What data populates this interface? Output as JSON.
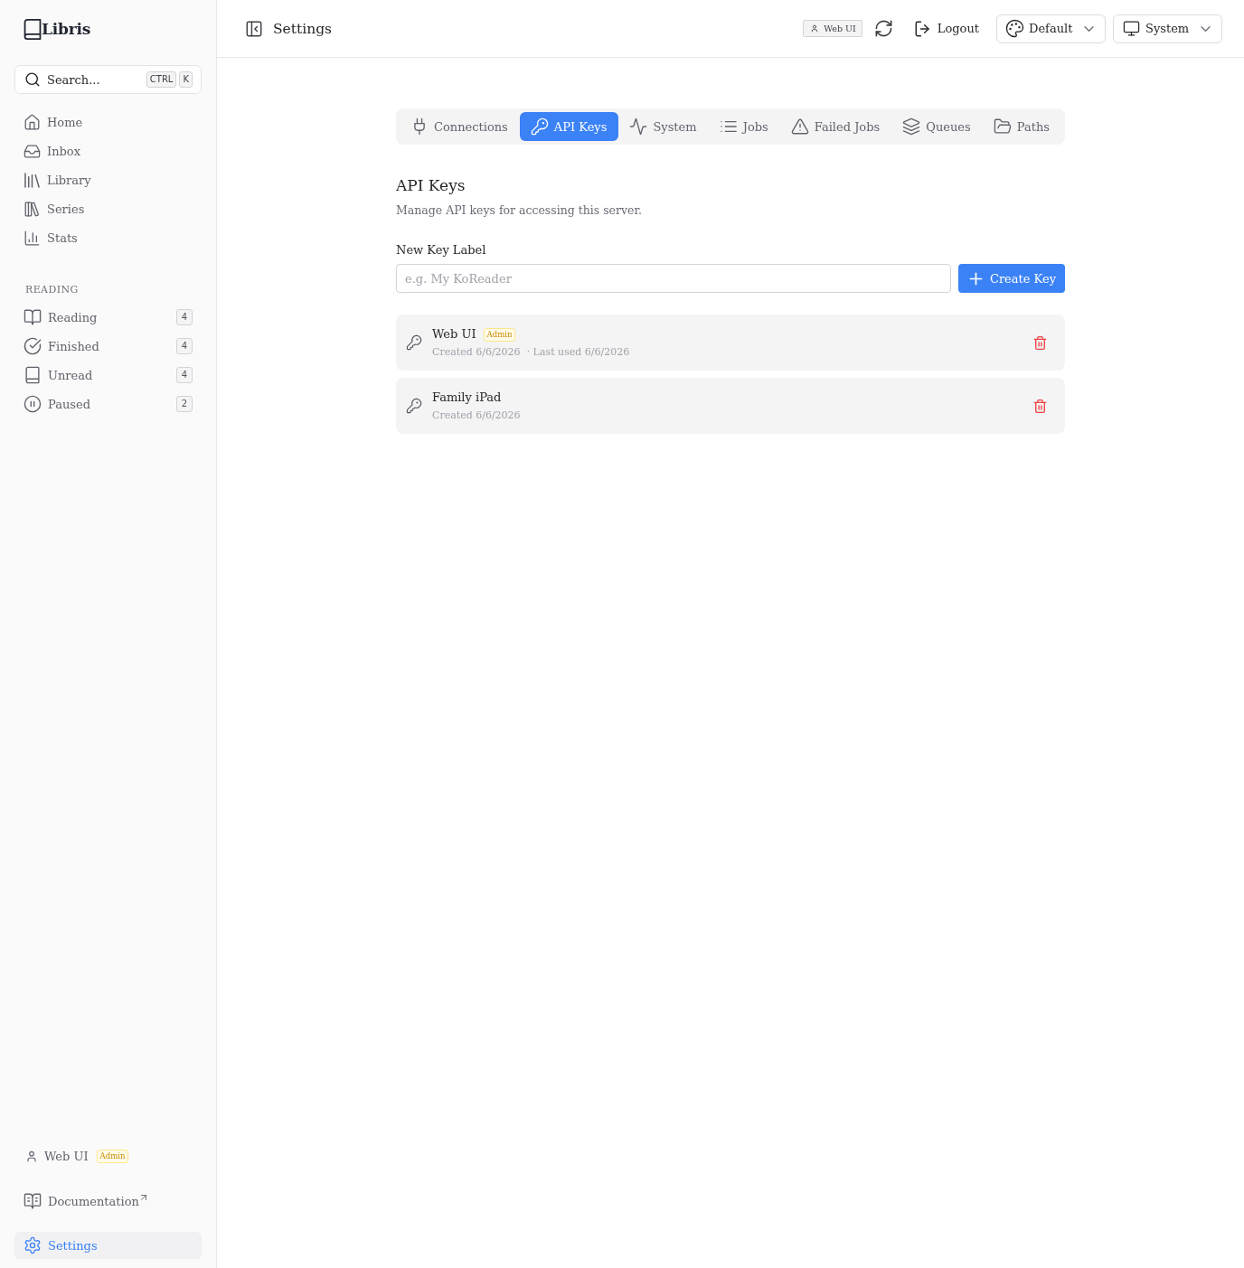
{
  "app": {
    "name": "Libris"
  },
  "sidebar": {
    "search": {
      "placeholder": "Search...",
      "shortcut_keys": [
        "CTRL",
        "K"
      ]
    },
    "nav": [
      {
        "label": "Home",
        "selected": false
      },
      {
        "label": "Inbox",
        "selected": false
      },
      {
        "label": "Library",
        "selected": false
      },
      {
        "label": "Series",
        "selected": false
      },
      {
        "label": "Stats",
        "selected": false
      }
    ],
    "reading": {
      "heading": "READING",
      "items": [
        {
          "label": "Reading",
          "count": "4",
          "selected": false
        },
        {
          "label": "Finished",
          "count": "4",
          "selected": false
        },
        {
          "label": "Unread",
          "count": "4",
          "selected": false
        },
        {
          "label": "Paused",
          "count": "2",
          "selected": false
        }
      ]
    },
    "user": {
      "name": "Web UI",
      "role": "Admin"
    },
    "footer_links": [
      {
        "label": "Documentation",
        "external": true,
        "selected": false
      },
      {
        "label": "Settings",
        "external": false,
        "selected": true
      }
    ]
  },
  "header": {
    "title": "Settings",
    "user_badge": "Web UI",
    "logout": "Logout",
    "theme": "Default",
    "mode": "System"
  },
  "tabs": [
    {
      "label": "Connections",
      "selected": false
    },
    {
      "label": "API Keys",
      "selected": true
    },
    {
      "label": "System",
      "selected": false
    },
    {
      "label": "Jobs",
      "selected": false
    },
    {
      "label": "Failed Jobs",
      "selected": false
    },
    {
      "label": "Queues",
      "selected": false
    },
    {
      "label": "Paths",
      "selected": false
    }
  ],
  "api_keys": {
    "title": "API Keys",
    "description": "Manage API keys for accessing this server.",
    "new_key": {
      "label": "New Key Label",
      "placeholder": "e.g. My KoReader",
      "button": "Create Key"
    },
    "keys": [
      {
        "name": "Web UI",
        "role": "Admin",
        "created": "Created 6/6/2026",
        "last_used": "· Last used 6/6/2026"
      },
      {
        "name": "Family iPad",
        "created": "Created 6/6/2026"
      }
    ]
  }
}
